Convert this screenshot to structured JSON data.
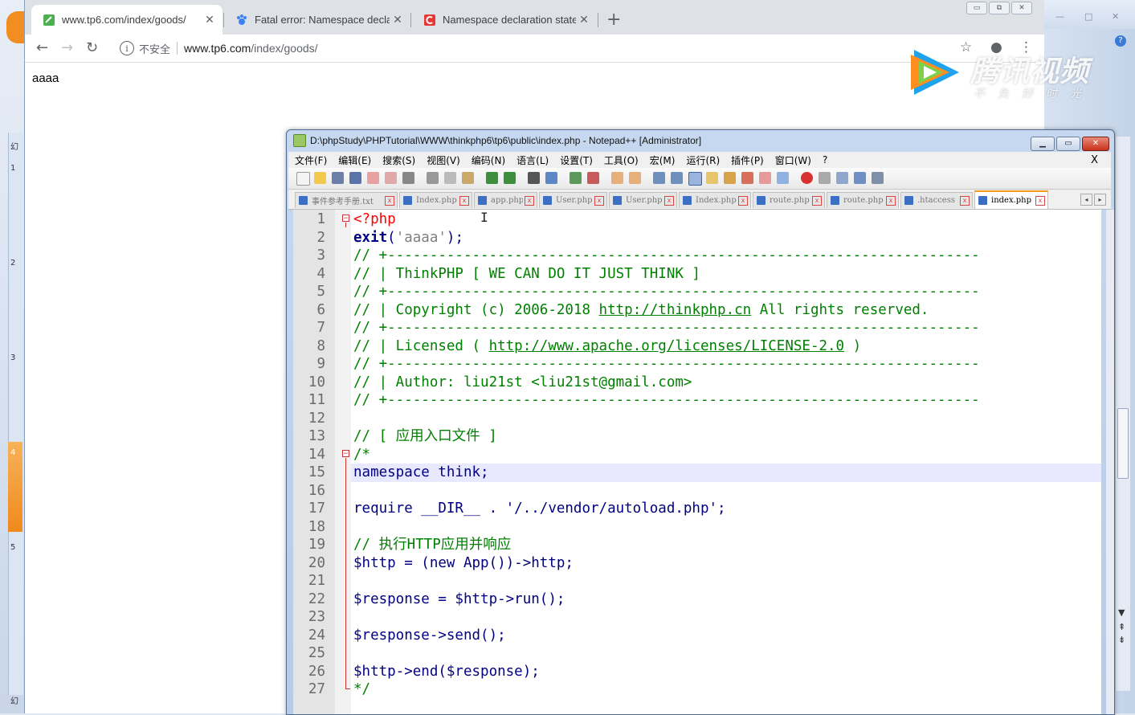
{
  "browser": {
    "tabs": [
      {
        "title": "www.tp6.com/index/goods/",
        "active": true
      },
      {
        "title": "Fatal error: Namespace declar",
        "active": false
      },
      {
        "title": "Namespace declaration staten",
        "active": false
      }
    ],
    "new_tab": "+",
    "omnibox": {
      "security": "不安全",
      "url_host": "www.tp6.com",
      "url_path": "/index/goods/"
    },
    "page_text": "aaaa"
  },
  "overlay": {
    "brand": "腾讯视频",
    "slogan": "不负好时光"
  },
  "left_window": {
    "labels": [
      "幻",
      "1",
      "2",
      "3",
      "4",
      "5",
      "幻"
    ]
  },
  "notepad": {
    "title": "D:\\phpStudy\\PHPTutorial\\WWW\\thinkphp6\\tp6\\public\\index.php - Notepad++ [Administrator]",
    "menu": [
      "文件(F)",
      "编辑(E)",
      "搜索(S)",
      "视图(V)",
      "编码(N)",
      "语言(L)",
      "设置(T)",
      "工具(O)",
      "宏(M)",
      "运行(R)",
      "插件(P)",
      "窗口(W)",
      "?"
    ],
    "menu_close": "X",
    "file_tabs": [
      {
        "label": "事件参考手册.txt",
        "active": false
      },
      {
        "label": "Index.php",
        "active": false
      },
      {
        "label": "app.php",
        "active": false
      },
      {
        "label": "User.php",
        "active": false
      },
      {
        "label": "User.php",
        "active": false
      },
      {
        "label": "Index.php",
        "active": false
      },
      {
        "label": "route.php",
        "active": false
      },
      {
        "label": "route.php",
        "active": false
      },
      {
        "label": ".htaccess",
        "active": false
      },
      {
        "label": "index.php",
        "active": true
      }
    ],
    "current_line": 15,
    "lines": [
      {
        "n": "1",
        "t": "<?php"
      },
      {
        "n": "2",
        "t": "exit('aaaa');"
      },
      {
        "n": "3",
        "t": "// +----------------------------------------------------------------------"
      },
      {
        "n": "4",
        "t": "// | ThinkPHP [ WE CAN DO IT JUST THINK ]"
      },
      {
        "n": "5",
        "t": "// +----------------------------------------------------------------------"
      },
      {
        "n": "6",
        "t": "// | Copyright (c) 2006-2018 http://thinkphp.cn All rights reserved."
      },
      {
        "n": "7",
        "t": "// +----------------------------------------------------------------------"
      },
      {
        "n": "8",
        "t": "// | Licensed ( http://www.apache.org/licenses/LICENSE-2.0 )"
      },
      {
        "n": "9",
        "t": "// +----------------------------------------------------------------------"
      },
      {
        "n": "10",
        "t": "// | Author: liu21st <liu21st@gmail.com>"
      },
      {
        "n": "11",
        "t": "// +----------------------------------------------------------------------"
      },
      {
        "n": "12",
        "t": ""
      },
      {
        "n": "13",
        "t": "// [ 应用入口文件 ]"
      },
      {
        "n": "14",
        "t": "/*"
      },
      {
        "n": "15",
        "t": "namespace think;"
      },
      {
        "n": "16",
        "t": ""
      },
      {
        "n": "17",
        "t": "require __DIR__ . '/../vendor/autoload.php';"
      },
      {
        "n": "18",
        "t": ""
      },
      {
        "n": "19",
        "t": "// 执行HTTP应用并响应"
      },
      {
        "n": "20",
        "t": "$http = (new App())->http;"
      },
      {
        "n": "21",
        "t": ""
      },
      {
        "n": "22",
        "t": "$response = $http->run();"
      },
      {
        "n": "23",
        "t": ""
      },
      {
        "n": "24",
        "t": "$response->send();"
      },
      {
        "n": "25",
        "t": ""
      },
      {
        "n": "26",
        "t": "$http->end($response);"
      },
      {
        "n": "27",
        "t": "*/"
      }
    ]
  },
  "colors": {
    "comment": "#008000",
    "php_tag": "#ff0000",
    "keyword": "#000080",
    "string": "#808080",
    "current_line_bg": "#e8e8ff"
  }
}
